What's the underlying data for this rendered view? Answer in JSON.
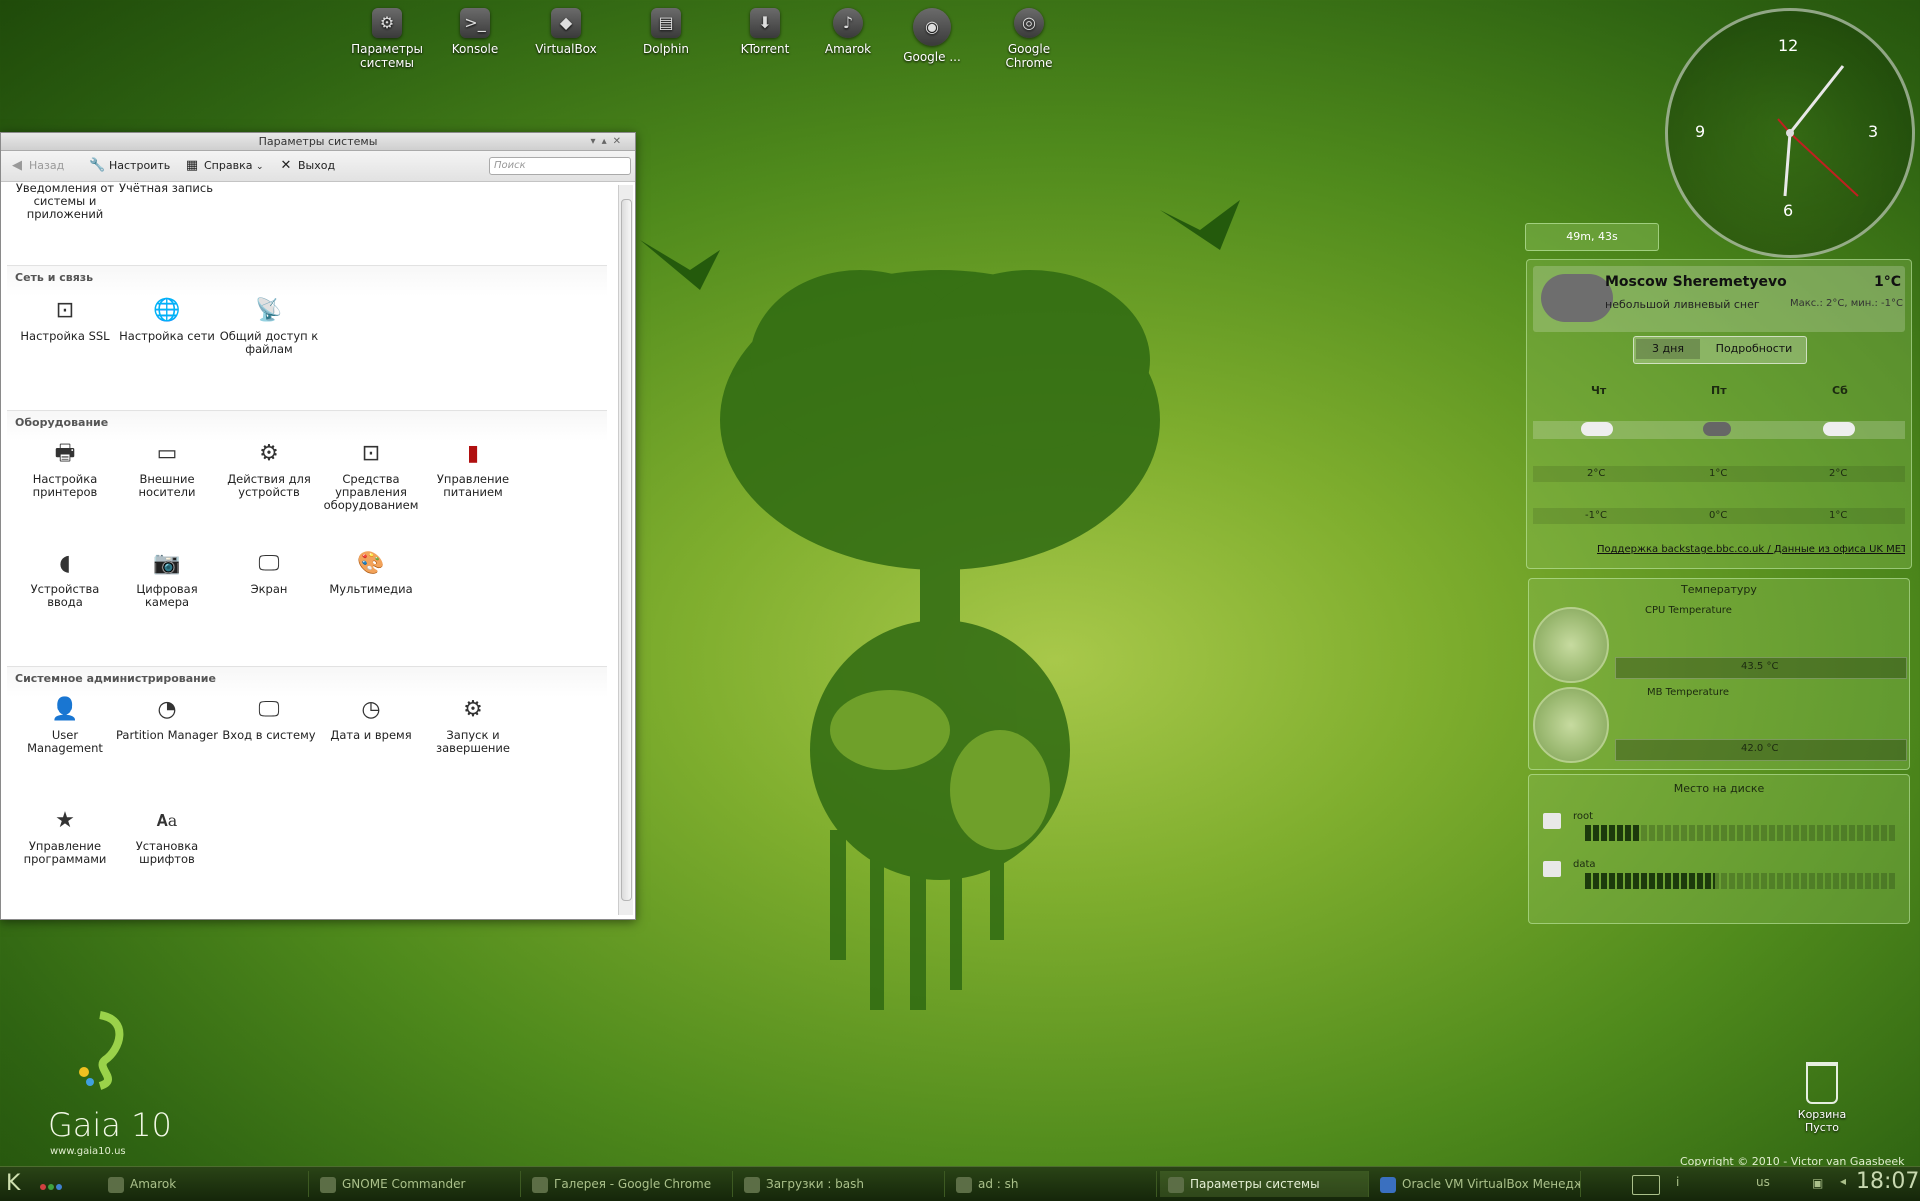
{
  "desktop": {
    "icons": [
      {
        "label": "Параметры системы",
        "icon": "settings-icon"
      },
      {
        "label": "Konsole",
        "icon": "terminal-icon"
      },
      {
        "label": "VirtualBox",
        "icon": "virtualbox-icon"
      },
      {
        "label": "Dolphin",
        "icon": "file-manager-icon"
      },
      {
        "label": "KTorrent",
        "icon": "torrent-icon"
      },
      {
        "label": "Amarok",
        "icon": "music-icon"
      },
      {
        "label": "Google ...",
        "icon": "google-earth-icon"
      },
      {
        "label": "Google Chrome",
        "icon": "chrome-icon"
      }
    ],
    "logo": {
      "name": "Gaia 10",
      "url": "www.gaia10.us"
    },
    "trash": {
      "label": "Корзина",
      "status": "Пусто"
    },
    "copyright": "Copyright ©  2010 - Victor van Gaasbeek"
  },
  "window": {
    "title": "Параметры системы",
    "toolbar": {
      "back": "Назад",
      "configure": "Настроить",
      "help": "Справка",
      "exit": "Выход",
      "search_placeholder": "Поиск"
    },
    "top_items": [
      {
        "label": "Уведомления от системы и приложений"
      },
      {
        "label": "Учётная запись"
      }
    ],
    "sections": [
      {
        "title": "Сеть и связь",
        "items": [
          {
            "label": "Настройка SSL",
            "icon": "ssl-icon"
          },
          {
            "label": "Настройка сети",
            "icon": "globe-icon"
          },
          {
            "label": "Общий доступ к файлам",
            "icon": "file-share-icon"
          }
        ]
      },
      {
        "title": "Оборудование",
        "items": [
          {
            "label": "Настройка принтеров",
            "icon": "printer-icon"
          },
          {
            "label": "Внешние носители",
            "icon": "drive-icon"
          },
          {
            "label": "Действия для устройств",
            "icon": "gear-icon"
          },
          {
            "label": "Средства управления оборудованием",
            "icon": "hardware-icon"
          },
          {
            "label": "Управление питанием",
            "icon": "battery-icon"
          },
          {
            "label": "Устройства ввода",
            "icon": "mouse-icon"
          },
          {
            "label": "Цифровая камера",
            "icon": "camera-icon"
          },
          {
            "label": "Экран",
            "icon": "monitor-icon"
          },
          {
            "label": "Мультимедиа",
            "icon": "multimedia-icon"
          }
        ]
      },
      {
        "title": "Системное администрирование",
        "items": [
          {
            "label": "User Management",
            "icon": "user-icon"
          },
          {
            "label": "Partition Manager",
            "icon": "partition-icon"
          },
          {
            "label": "Вход в систему",
            "icon": "login-icon"
          },
          {
            "label": "Дата и время",
            "icon": "clock-icon"
          },
          {
            "label": "Запуск и завершение",
            "icon": "gear-icon"
          },
          {
            "label": "Управление программами",
            "icon": "star-icon"
          },
          {
            "label": "Установка шрифтов",
            "icon": "font-icon"
          }
        ]
      }
    ]
  },
  "widgets": {
    "timer": "49m, 43s",
    "clock": {
      "numbers": [
        "12",
        "3",
        "6",
        "9"
      ]
    },
    "weather": {
      "location": "Moscow Sheremetyevo",
      "temp": "1°C",
      "condition": "небольшой ливневый снег",
      "range": "Макс.: 2°C, мин.: -1°C",
      "tabs": [
        "3 дня",
        "Подробности"
      ],
      "days": [
        {
          "day": "Чт",
          "high": "2°C",
          "low": "-1°C"
        },
        {
          "day": "Пт",
          "high": "1°C",
          "low": "0°C"
        },
        {
          "day": "Сб",
          "high": "2°C",
          "low": "1°C"
        }
      ],
      "credit": "Поддержка backstage.bbc.co.uk / Данные из офиса UK MET"
    },
    "temperature": {
      "title": "Температуру",
      "sensors": [
        {
          "name": "CPU Temperature",
          "value": "43.5 °C"
        },
        {
          "name": "MB Temperature",
          "value": "42.0 °C"
        }
      ]
    },
    "disk": {
      "title": "Место на диске",
      "items": [
        {
          "name": "root",
          "used_fraction": 0.18
        },
        {
          "name": "data",
          "used_fraction": 0.42
        }
      ]
    }
  },
  "taskbar": {
    "tasks": [
      {
        "label": "Amarok"
      },
      {
        "label": "GNOME Commander"
      },
      {
        "label": "Галерея - Google Chrome"
      },
      {
        "label": "Загрузки : bash"
      },
      {
        "label": "ad : sh"
      },
      {
        "label": "Параметры системы"
      },
      {
        "label": "Oracle VM VirtualBox Менедж"
      }
    ],
    "layout": "us",
    "time": "18:07"
  }
}
